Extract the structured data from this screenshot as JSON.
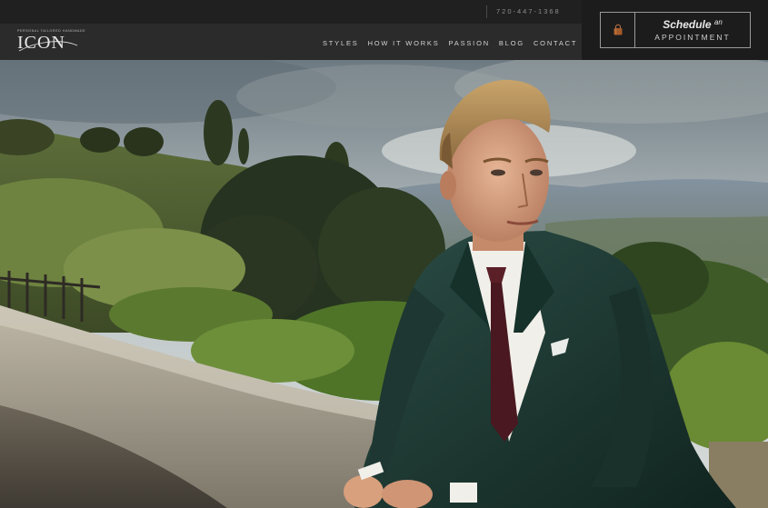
{
  "header": {
    "phone": "720-447-1368",
    "logo": {
      "tagline": "PERSONAL TAILORED HANDMADE",
      "wordmark": "ICON"
    },
    "nav": [
      {
        "label": "STYLES"
      },
      {
        "label": "HOW IT WORKS"
      },
      {
        "label": "PASSION"
      },
      {
        "label": "BLOG"
      },
      {
        "label": "CONTACT"
      }
    ],
    "appointment": {
      "icon": "shopping-bag-icon",
      "line1": "Schedule",
      "line1_small": "an",
      "line2": "APPOINTMENT"
    }
  },
  "colors": {
    "topbar": "#202020",
    "navbar": "#2b2b2b",
    "appointment_panel": "#1c1c1c",
    "suit": "#1d3a34",
    "tie": "#4a1820",
    "bag_icon": "#a35a2a"
  }
}
